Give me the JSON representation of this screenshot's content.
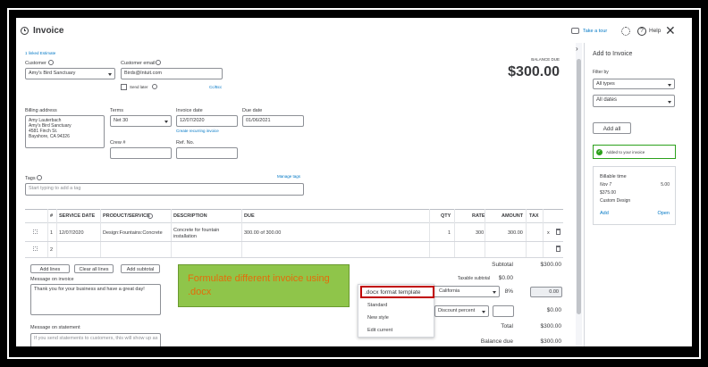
{
  "header": {
    "title": "Invoice",
    "take_tour": "Take a tour",
    "help": "Help"
  },
  "form": {
    "linked_estimate": "1 linked Estimate",
    "customer_label": "Customer",
    "customer_value": "Amy's Bird Sanctuary",
    "email_label": "Customer email",
    "email_value": "Birds@Intuit.com",
    "send_later": "Send later",
    "cc_bcc": "Cc/Bcc",
    "balance_due_label": "BALANCE DUE",
    "balance_due_value": "$300.00",
    "billing_label": "Billing address",
    "billing_lines": [
      "Amy Lauterbach",
      "Amy's Bird Sanctuary",
      "4581 Finch St.",
      "Bayshore, CA 94326"
    ],
    "terms_label": "Terms",
    "terms_value": "Net 30",
    "invoice_date_label": "Invoice date",
    "invoice_date_value": "12/07/2020",
    "due_date_label": "Due date",
    "due_date_value": "01/06/2021",
    "create_recurring": "Create recurring invoice",
    "crew_label": "Crew #",
    "ref_label": "Ref. No.",
    "tags_label": "Tags",
    "manage_tags": "Manage tags",
    "tags_placeholder": "Start typing to add a tag"
  },
  "table": {
    "headers": {
      "num": "#",
      "service_date": "SERVICE DATE",
      "product": "PRODUCT/SERVICE",
      "description": "DESCRIPTION",
      "due": "DUE",
      "qty": "QTY",
      "rate": "RATE",
      "amount": "AMOUNT",
      "tax": "TAX"
    },
    "rows": [
      {
        "num": "1",
        "service_date": "12/07/2020",
        "product": "Design:Fountains:Concrete",
        "description1": "Concrete for fountain",
        "description2": "installation",
        "due": "300.00 of 300.00",
        "qty": "1",
        "rate": "300",
        "amount": "300.00"
      },
      {
        "num": "2"
      }
    ],
    "add_lines": "Add lines",
    "clear_all_lines": "Clear all lines",
    "add_subtotal": "Add subtotal"
  },
  "messages": {
    "invoice_label": "Message on invoice",
    "invoice_text": "Thank you for your business and have a great day!",
    "statement_label": "Message on statement",
    "statement_text": "If you send statements to customers, this will show up as"
  },
  "summary": {
    "subtotal_label": "Subtotal",
    "subtotal_value": "$300.00",
    "taxable_label": "Taxable subtotal",
    "taxable_value": "$0.00",
    "tax_location": "California",
    "tax_rate": "8%",
    "tax_amount": "0.00",
    "discount_label": "Discount percent",
    "discount_value": "$0.00",
    "total_label": "Total",
    "total_value": "$300.00",
    "balance_label": "Balance due",
    "balance_value": "$300.00"
  },
  "dropdown": {
    "selected": ".docx format template",
    "options": [
      "Standard",
      "New style",
      "Edit current"
    ]
  },
  "annotation": {
    "text": "Formulate different invoice using .docx",
    "bg_color": "#8fc54a",
    "text_color": "#e46c0a",
    "highlight_color": "#c00000"
  },
  "side_panel": {
    "title": "Add to Invoice",
    "filter_label": "Filter by",
    "type_value": "All types",
    "date_value": "All dates",
    "add_all": "Add all",
    "added_text": "Added to your invoice",
    "card_title": "Billable time",
    "card_date": "Nov 7",
    "card_amount": "5.00",
    "card_total": "$375.00",
    "card_desc": "Custom Design",
    "card_add": "Add",
    "card_open": "Open"
  },
  "colors": {
    "brand_green": "#2ca01c",
    "link_blue": "#0077c5"
  }
}
